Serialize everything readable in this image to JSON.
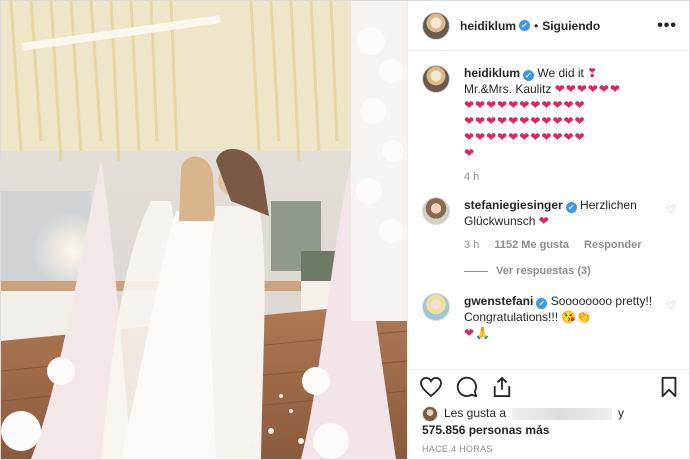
{
  "header": {
    "username": "heidiklum",
    "separator": "•",
    "follow_status": "Siguiendo",
    "more_icon": "ellipsis-icon"
  },
  "caption": {
    "username": "heidiklum",
    "line1": "We did it",
    "line1_emoji": "❣",
    "line2": "Mr.&Mrs. Kaulitz",
    "hearts_line2": "❤❤❤❤❤❤",
    "hearts_rows": [
      "❤❤❤❤❤❤❤❤❤❤❤",
      "❤❤❤❤❤❤❤❤❤❤❤",
      "❤❤❤❤❤❤❤❤❤❤❤",
      "❤"
    ],
    "time": "4 h"
  },
  "comments": [
    {
      "username": "stefaniegiesinger",
      "text": "Herzlichen Glückwunsch",
      "emoji": "❤",
      "time": "3 h",
      "likes": "1152 Me gusta",
      "reply": "Responder",
      "view_replies": "Ver respuestas (3)"
    },
    {
      "username": "gwenstefani",
      "text": "Soooooooo pretty!! Congratulations!!!",
      "emoji": "😘👏",
      "emoji2": "❤🙏"
    }
  ],
  "likes": {
    "prefix": "Les gusta a",
    "conj": "y",
    "count": "575.856 personas más"
  },
  "timestamp": "HACE 4 HORAS",
  "icons": {
    "like": "heart-outline-icon",
    "comment": "comment-icon",
    "share": "share-icon",
    "save": "bookmark-icon"
  },
  "colors": {
    "verified": "#3897f0",
    "heart": "#e0245e",
    "muted": "#8e8e8e"
  }
}
